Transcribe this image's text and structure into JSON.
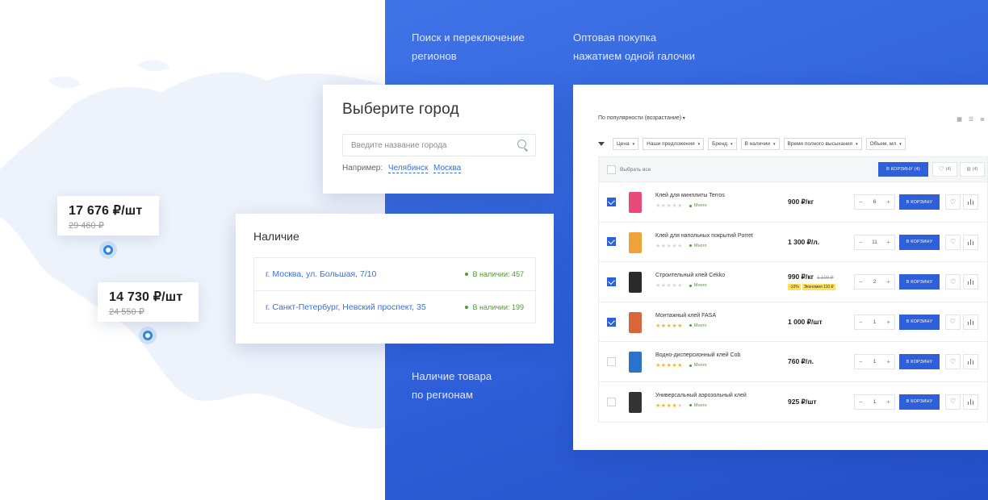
{
  "captions": {
    "region_search": [
      "Поиск и переключение",
      "регионов"
    ],
    "wholesale": [
      "Оптовая покупка",
      "нажатием одной галочки"
    ],
    "availability": [
      "Наличие товара",
      "по регионам"
    ]
  },
  "map_prices": [
    {
      "price": "17 676 ₽/шт",
      "old": "29 460 ₽"
    },
    {
      "price": "14 730 ₽/шт",
      "old": "24 550 ₽"
    }
  ],
  "city_picker": {
    "title": "Выберите город",
    "placeholder": "Введите название города",
    "example_label": "Например:",
    "examples": [
      "Челябинск",
      "Москва"
    ]
  },
  "availability": {
    "title": "Наличие",
    "rows": [
      {
        "address": "г. Москва, ул. Большая, 7/10",
        "stock": "В наличии: 457"
      },
      {
        "address": "г. Санкт-Петербург, Невский проспект, 35",
        "stock": "В наличии: 199"
      }
    ]
  },
  "catalog": {
    "sort": "По популярности (возрастание)",
    "filters": [
      "Цена",
      "Наши предложения",
      "Бренд",
      "В наличии",
      "Время полного высыхания",
      "Объем, мл"
    ],
    "select_all": "Выбрать все",
    "cart_all": "В КОРЗИНУ (4)",
    "fav_count": "(4)",
    "cmp_count": "(4)",
    "products": [
      {
        "name": "Клей для минплиты Terros",
        "price": "900 ₽/кг",
        "old": "",
        "promo": [],
        "qty": "6",
        "stars": 0,
        "stock": "Много",
        "checked": true,
        "color": "#e84b7a"
      },
      {
        "name": "Клей для напольных покрытий Porret",
        "price": "1 300 ₽/л.",
        "old": "",
        "promo": [],
        "qty": "11",
        "stars": 0,
        "stock": "Много",
        "checked": true,
        "color": "#f0a23a"
      },
      {
        "name": "Строительный клей Cekko",
        "price": "990 ₽/кг",
        "old": "1 100 ₽",
        "promo": [
          "-10%",
          "Экономия 110 ₽"
        ],
        "qty": "2",
        "stars": 0,
        "stock": "Много",
        "checked": true,
        "color": "#2a2a2a"
      },
      {
        "name": "Монтажный клей FASA",
        "price": "1 000 ₽/шт",
        "old": "",
        "promo": [],
        "qty": "1",
        "stars": 5,
        "stock": "Много",
        "checked": true,
        "color": "#d9653a"
      },
      {
        "name": "Водно-дисперсионный клей Cob",
        "price": "760 ₽/л.",
        "old": "",
        "promo": [],
        "qty": "1",
        "stars": 5,
        "stock": "Много",
        "checked": false,
        "color": "#2a73c9"
      },
      {
        "name": "Универсальный аэрозольный клей",
        "price": "925 ₽/шт",
        "old": "",
        "promo": [],
        "qty": "1",
        "stars": 4,
        "stock": "Много",
        "checked": false,
        "color": "#333333"
      }
    ],
    "to_cart_label": "В КОРЗИНУ"
  },
  "colors": {
    "accent": "#2f5fd9",
    "stock": "#4f9a2e",
    "background_blue": "#3463dc"
  }
}
